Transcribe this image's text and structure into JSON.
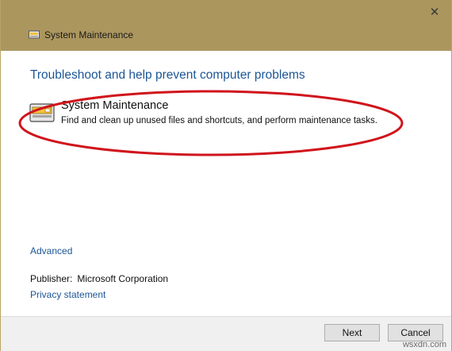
{
  "window": {
    "title": "System Maintenance",
    "close_glyph": "✕",
    "titlebar_color": "#ab965e"
  },
  "main": {
    "heading": "Troubleshoot and help prevent computer problems",
    "task": {
      "title": "System Maintenance",
      "description": "Find and clean up unused files and shortcuts, and perform maintenance tasks.",
      "icon": "system-maintenance-icon"
    },
    "highlight_color": "#d0141c",
    "advanced_link": "Advanced",
    "publisher_label": "Publisher:",
    "publisher_value": "Microsoft Corporation",
    "privacy_link": "Privacy statement"
  },
  "footer": {
    "next_label": "Next",
    "cancel_label": "Cancel"
  },
  "watermark": "wsxdn.com"
}
